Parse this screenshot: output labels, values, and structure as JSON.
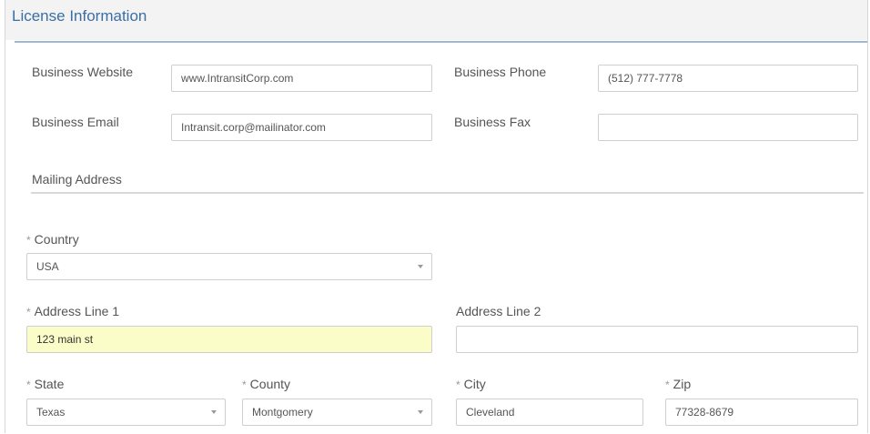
{
  "panel": {
    "title": "License Information"
  },
  "business": {
    "website": {
      "label": "Business Website",
      "value": "www.IntransitCorp.com"
    },
    "phone": {
      "label": "Business Phone",
      "value": "(512) 777-7778"
    },
    "email": {
      "label": "Business Email",
      "value": "Intransit.corp@mailinator.com"
    },
    "fax": {
      "label": "Business Fax",
      "value": ""
    }
  },
  "mailing": {
    "title": "Mailing Address",
    "required_marker": "*",
    "country": {
      "label": "Country",
      "value": "USA"
    },
    "address1": {
      "label": "Address Line 1",
      "value": "123 main st"
    },
    "address2": {
      "label": "Address Line 2",
      "value": ""
    },
    "state": {
      "label": "State",
      "value": "Texas"
    },
    "county": {
      "label": "County",
      "value": "Montgomery"
    },
    "city": {
      "label": "City",
      "value": "Cleveland"
    },
    "zip": {
      "label": "Zip",
      "value": "77328-8679"
    }
  },
  "colors": {
    "title_blue": "#3a6ea5",
    "highlight_input": "#fbfdc8"
  }
}
